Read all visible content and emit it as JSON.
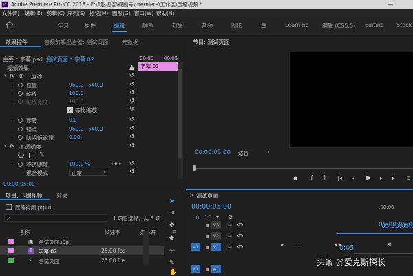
{
  "window": {
    "title": "Adobe Premiere Pro CC 2018 - E:\\1影视区\\视频号\\premiere\\工作区\\压缩视频 *",
    "app_icon": "Pr",
    "minimize": "—"
  },
  "menu": [
    "文件(F)",
    "编辑(E)",
    "剪辑(C)",
    "序列(S)",
    "标记(M)",
    "图形(G)",
    "窗口(W)",
    "帮助(H)"
  ],
  "workspaces": {
    "items": [
      "学习",
      "组件",
      "编辑",
      "颜色",
      "效果",
      "音频",
      "图形",
      "库",
      "Learning",
      "编辑 (CS5.5)",
      "Editing",
      "Stock W"
    ],
    "active": "编辑"
  },
  "effect_controls": {
    "tabs": [
      "效果控件",
      "音频剪辑混合器: 测试页面",
      "元数据"
    ],
    "active_tab": "效果控件",
    "source_label": "主要 * 字幕.psd",
    "clip_path": "测试页面 * 字幕 02",
    "timecode_ruler": [
      "00:00",
      "00:05"
    ],
    "clip_name": "字幕 02",
    "section": "视频效果",
    "motion": "运动",
    "position_label": "位置",
    "position_x": "960.0",
    "position_y": "540.0",
    "scale_label": "缩放",
    "scale_value": "100.0",
    "scale_width_label": "缩放宽度",
    "scale_width_value": "100.0",
    "uniform_scale": "等比缩放",
    "rotation_label": "旋转",
    "rotation_value": "0.0",
    "anchor_label": "锚点",
    "anchor_x": "960.0",
    "anchor_y": "540.0",
    "anti_flicker_label": "防闪烁滤镜",
    "anti_flicker_value": "0.00",
    "opacity_section": "不透明度",
    "opacity_label": "不透明度",
    "opacity_value": "100.0 %",
    "blend_label": "混合模式",
    "blend_value": "正常",
    "fx": "fx",
    "timecode": "00:00:05:00"
  },
  "program": {
    "title": "节目: 测试页面",
    "timecode": "00:00:05:00",
    "fit": "适合",
    "controls": [
      "●",
      "{",
      "}",
      "|◂",
      "◂|",
      "◂",
      "▶",
      "▸",
      "▸|",
      "⊐",
      "⊏",
      "⬚",
      "⊡",
      "+"
    ]
  },
  "project": {
    "tabs": [
      "项目: 压缩视频",
      "效果"
    ],
    "file": "压缩视频.prproj",
    "selection_info": "1 项已选择，共 3 项",
    "columns": [
      "名称",
      "帧速率",
      "媒体开"
    ],
    "items": [
      {
        "name": "测试页面.jpg",
        "rate": "",
        "color": "#e088e8"
      },
      {
        "name": "字幕 02",
        "rate": "25.00 fps",
        "color": "#e088e8"
      },
      {
        "name": "测试页面",
        "rate": "25.00 fps",
        "color": "#3db84a"
      }
    ]
  },
  "timeline": {
    "title": "测试页面",
    "timecode": "00:00:05:00",
    "ruler_left": ":00:00",
    "ruler_right": "05:00:05:00",
    "track_labels": [
      "V3",
      "V2",
      "V1",
      "A1"
    ],
    "source_v": "V1",
    "source_a": "A1",
    "snippet_timecode": "0:05",
    "right_timecode": "05:00:05:00"
  },
  "watermark": "头条 @爱克斯探长"
}
